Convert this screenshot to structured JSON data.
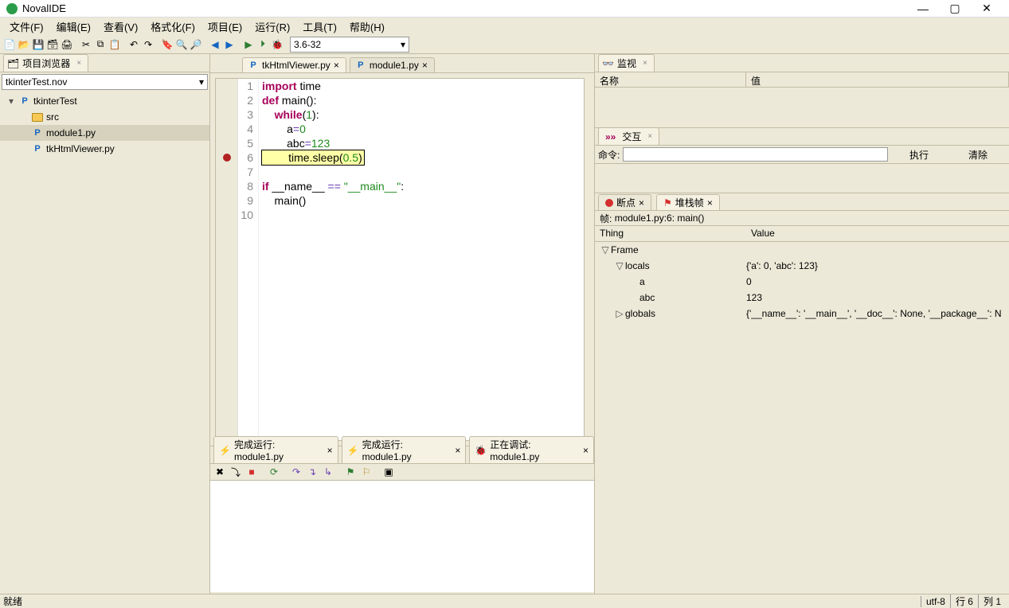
{
  "app": {
    "title": "NovalIDE"
  },
  "window_controls": {
    "min": "—",
    "max": "▢",
    "close": "✕"
  },
  "menu": [
    "文件(F)",
    "编辑(E)",
    "查看(V)",
    "格式化(F)",
    "项目(E)",
    "运行(R)",
    "工具(T)",
    "帮助(H)"
  ],
  "python_version": "3.6-32",
  "left": {
    "panel_title": "项目浏览器",
    "project_dropdown": "tkinterTest.nov",
    "tree": [
      {
        "depth": 0,
        "expander": "▾",
        "icon": "py",
        "label": "tkinterTest"
      },
      {
        "depth": 1,
        "expander": "",
        "icon": "folder",
        "label": "src"
      },
      {
        "depth": 1,
        "expander": "",
        "icon": "py",
        "label": "module1.py",
        "sel": true
      },
      {
        "depth": 1,
        "expander": "",
        "icon": "py",
        "label": "tkHtmlViewer.py"
      }
    ]
  },
  "editor": {
    "tabs": [
      {
        "label": "tkHtmlViewer.py",
        "active": true
      },
      {
        "label": "module1.py",
        "active": false
      }
    ],
    "breakpoint_line": 6,
    "lines": [
      {
        "n": 1,
        "html": "<span class='kw'>import</span> time"
      },
      {
        "n": 2,
        "html": "<span class='kw'>def</span> <span class='fn'>main</span>():"
      },
      {
        "n": 3,
        "html": "    <span class='kw'>while</span>(<span class='num'>1</span>):"
      },
      {
        "n": 4,
        "html": "        a<span class='op'>=</span><span class='num'>0</span>"
      },
      {
        "n": 5,
        "html": "        abc<span class='op'>=</span><span class='num'>123</span>"
      },
      {
        "n": 6,
        "html": "        time.sleep(<span class='num'>0.5</span>)",
        "hl": true
      },
      {
        "n": 7,
        "html": ""
      },
      {
        "n": 8,
        "html": "<span class='kw'>if</span> __name__ <span class='op'>==</span> <span class='str'>\"__main__\"</span>:"
      },
      {
        "n": 9,
        "html": "    main()"
      },
      {
        "n": 10,
        "html": ""
      }
    ]
  },
  "console": {
    "tabs": [
      {
        "icon": "bolt",
        "label": "完成运行: module1.py"
      },
      {
        "icon": "bolt",
        "label": "完成运行: module1.py"
      },
      {
        "icon": "bug",
        "label": "正在调试: module1.py"
      }
    ]
  },
  "right": {
    "watch_tab": "监视",
    "watch_cols": {
      "name": "名称",
      "value": "值"
    },
    "interact_label": "交互",
    "cmd_label": "命令:",
    "exec_btn": "执行",
    "clear_btn": "清除",
    "debug_tabs": {
      "bp": "断点",
      "stack": "堆栈帧"
    },
    "frame_label": "帧:",
    "frame_value": "module1.py:6: main()",
    "var_cols": {
      "thing": "Thing",
      "value": "Value"
    },
    "vars": [
      {
        "depth": 0,
        "exp": "▽",
        "k": "Frame",
        "v": ""
      },
      {
        "depth": 1,
        "exp": "▽",
        "k": "locals",
        "v": "{'a': 0, 'abc': 123}"
      },
      {
        "depth": 2,
        "exp": "",
        "k": "a",
        "v": "0"
      },
      {
        "depth": 2,
        "exp": "",
        "k": "abc",
        "v": "123"
      },
      {
        "depth": 1,
        "exp": "▷",
        "k": "globals",
        "v": "{'__name__': '__main__', '__doc__': None, '__package__': N"
      }
    ]
  },
  "status": {
    "ready": "就绪",
    "enc": "utf-8",
    "line": "行 6",
    "col": "列 1"
  }
}
